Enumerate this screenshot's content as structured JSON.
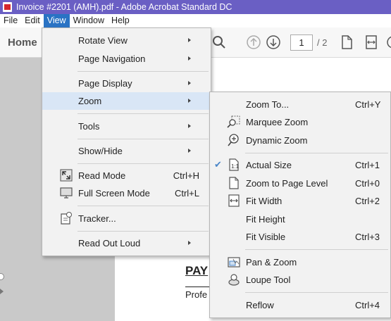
{
  "window": {
    "title": "Invoice #2201 (AMH).pdf - Adobe Acrobat Standard DC",
    "icon": "acrobat-pdf-icon"
  },
  "menubar": {
    "items": [
      "File",
      "Edit",
      "View",
      "Window",
      "Help"
    ],
    "active": "View"
  },
  "toolbar": {
    "home_label": "Home",
    "page_current": "1",
    "page_total": "/ 2",
    "icons": [
      "search-icon",
      "prev-page-icon",
      "next-page-icon",
      "page-icon",
      "fit-width-icon"
    ]
  },
  "document": {
    "heading": "PAY",
    "text": "Profe"
  },
  "view_menu": {
    "items": [
      {
        "label": "Rotate View",
        "submenu": true
      },
      {
        "label": "Page Navigation",
        "submenu": true
      },
      {
        "label": "Page Display",
        "submenu": true
      },
      {
        "label": "Zoom",
        "submenu": true,
        "highlighted": true
      },
      {
        "label": "Tools",
        "submenu": true
      },
      {
        "label": "Show/Hide",
        "submenu": true
      },
      {
        "label": "Read Mode",
        "shortcut": "Ctrl+H",
        "icon": "read-mode-icon"
      },
      {
        "label": "Full Screen Mode",
        "shortcut": "Ctrl+L",
        "icon": "full-screen-icon"
      },
      {
        "label": "Tracker...",
        "icon": "tracker-icon"
      },
      {
        "label": "Read Out Loud",
        "submenu": true
      }
    ]
  },
  "zoom_menu": {
    "items": [
      {
        "label": "Zoom To...",
        "shortcut": "Ctrl+Y"
      },
      {
        "label": "Marquee Zoom",
        "icon": "marquee-zoom-icon"
      },
      {
        "label": "Dynamic Zoom",
        "icon": "dynamic-zoom-icon"
      },
      {
        "label": "Actual Size",
        "shortcut": "Ctrl+1",
        "icon": "actual-size-icon",
        "checked": true
      },
      {
        "label": "Zoom to Page Level",
        "shortcut": "Ctrl+0",
        "icon": "page-level-icon"
      },
      {
        "label": "Fit Width",
        "shortcut": "Ctrl+2",
        "icon": "fit-width-icon"
      },
      {
        "label": "Fit Height"
      },
      {
        "label": "Fit Visible",
        "shortcut": "Ctrl+3"
      },
      {
        "label": "Pan & Zoom",
        "icon": "pan-zoom-icon"
      },
      {
        "label": "Loupe Tool",
        "icon": "loupe-tool-icon"
      },
      {
        "label": "Reflow",
        "shortcut": "Ctrl+4"
      }
    ]
  },
  "colors": {
    "titlebar": "#6a5fc4",
    "menu_active": "#2a73c4",
    "highlight": "#d9e6f6",
    "checkmark": "#4a86c8"
  }
}
